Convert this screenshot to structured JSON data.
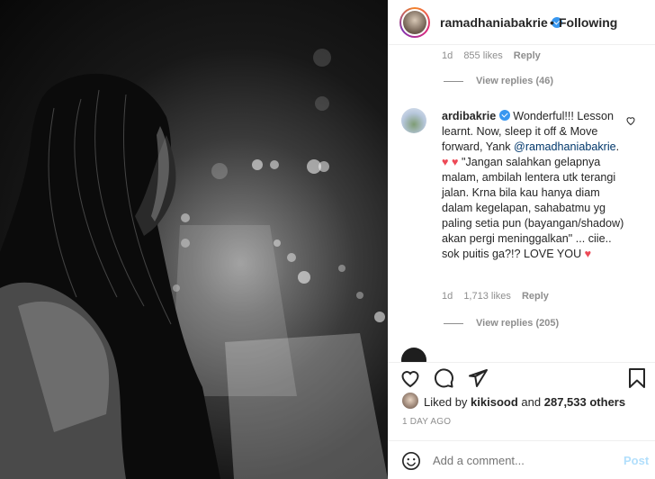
{
  "header": {
    "username": "ramadhaniabakrie",
    "separator": "•",
    "follow_state": "Following"
  },
  "comments": {
    "previous": {
      "time": "1d",
      "likes": "855 likes",
      "reply": "Reply",
      "view_replies": "View replies (46)"
    },
    "main": {
      "username": "ardibakrie",
      "text_1": "Wonderful!!! Lesson learnt. Now, sleep it off & Move forward, Yank",
      "mention": "@ramadhaniabakrie",
      "text_2": ". ",
      "hearts": "♥ ♥",
      "text_3": "\"Jangan salahkan gelapnya malam, ambilah lentera utk terangi jalan. Krna bila kau hanya diam dalam kegelapan, sahabatmu yg paling setia pun (bayangan/shadow) akan pergi meninggalkan\" ... ciie.. sok puitis ga?!? LOVE YOU",
      "heart_end": "♥",
      "time": "1d",
      "likes": "1,713 likes",
      "reply": "Reply",
      "view_replies": "View replies (205)"
    }
  },
  "actions": {
    "liked_by_prefix": "Liked by",
    "liked_by_user": "kikisood",
    "liked_by_and": "and",
    "likes_count": "287,533 others",
    "timestamp": "1 DAY AGO"
  },
  "comment_box": {
    "placeholder": "Add a comment...",
    "post_label": "Post"
  },
  "icons": {
    "heart": "heart-icon",
    "comment": "comment-icon",
    "share": "share-icon",
    "save": "bookmark-icon",
    "verified": "verified-badge-icon",
    "like_comment": "heart-outline-icon"
  },
  "colors": {
    "verified_blue": "#3897f0",
    "mention_blue": "#00376b",
    "heart_red": "#ed4956",
    "muted_gray": "#8e8e8e",
    "post_disabled": "#b2dffc"
  }
}
